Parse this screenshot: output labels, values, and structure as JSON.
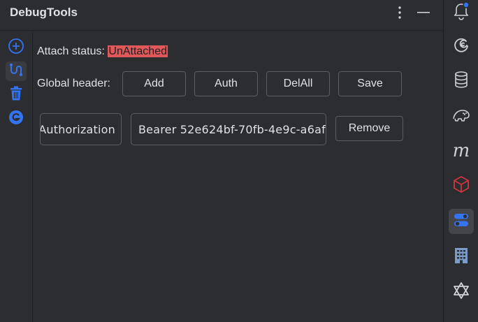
{
  "header": {
    "title": "DebugTools",
    "more_icon": "vertical-ellipsis-icon",
    "minimize_icon": "minimize-icon"
  },
  "left_toolbar": {
    "items": [
      {
        "name": "add",
        "icon": "plus-circle-icon",
        "color": "#3574f0"
      },
      {
        "name": "connect",
        "icon": "connect-icon",
        "color": "#3574f0",
        "active": true
      },
      {
        "name": "delete",
        "icon": "trash-icon",
        "color": "#3574f0"
      },
      {
        "name": "github",
        "icon": "github-icon",
        "color": "#3574f0"
      }
    ]
  },
  "main": {
    "attach_status_label": "Attach status:",
    "attach_status_value": "UnAttached",
    "attach_status_color": "#e0585a",
    "global_header_label": "Global header:",
    "buttons": {
      "add": "Add",
      "auth": "Auth",
      "delall": "DelAll",
      "save": "Save"
    },
    "header_row": {
      "key": "Authorization",
      "value": "Bearer 52e624bf-70fb-4e9c-a6af",
      "remove_label": "Remove"
    }
  },
  "right_toolbar": {
    "items": [
      {
        "icon": "notifications-bell-icon",
        "badge_color": "#3574f0"
      },
      {
        "icon": "swirl-icon"
      },
      {
        "icon": "database-icon"
      },
      {
        "icon": "elephant-icon"
      },
      {
        "icon": "m-letter-icon",
        "text": "m"
      },
      {
        "icon": "red-cube-icon",
        "color": "#d0353f"
      },
      {
        "icon": "debugtools-toggle-icon",
        "color": "#3574f0",
        "active": true
      },
      {
        "icon": "building-icon"
      },
      {
        "icon": "star-of-david-icon"
      }
    ]
  }
}
